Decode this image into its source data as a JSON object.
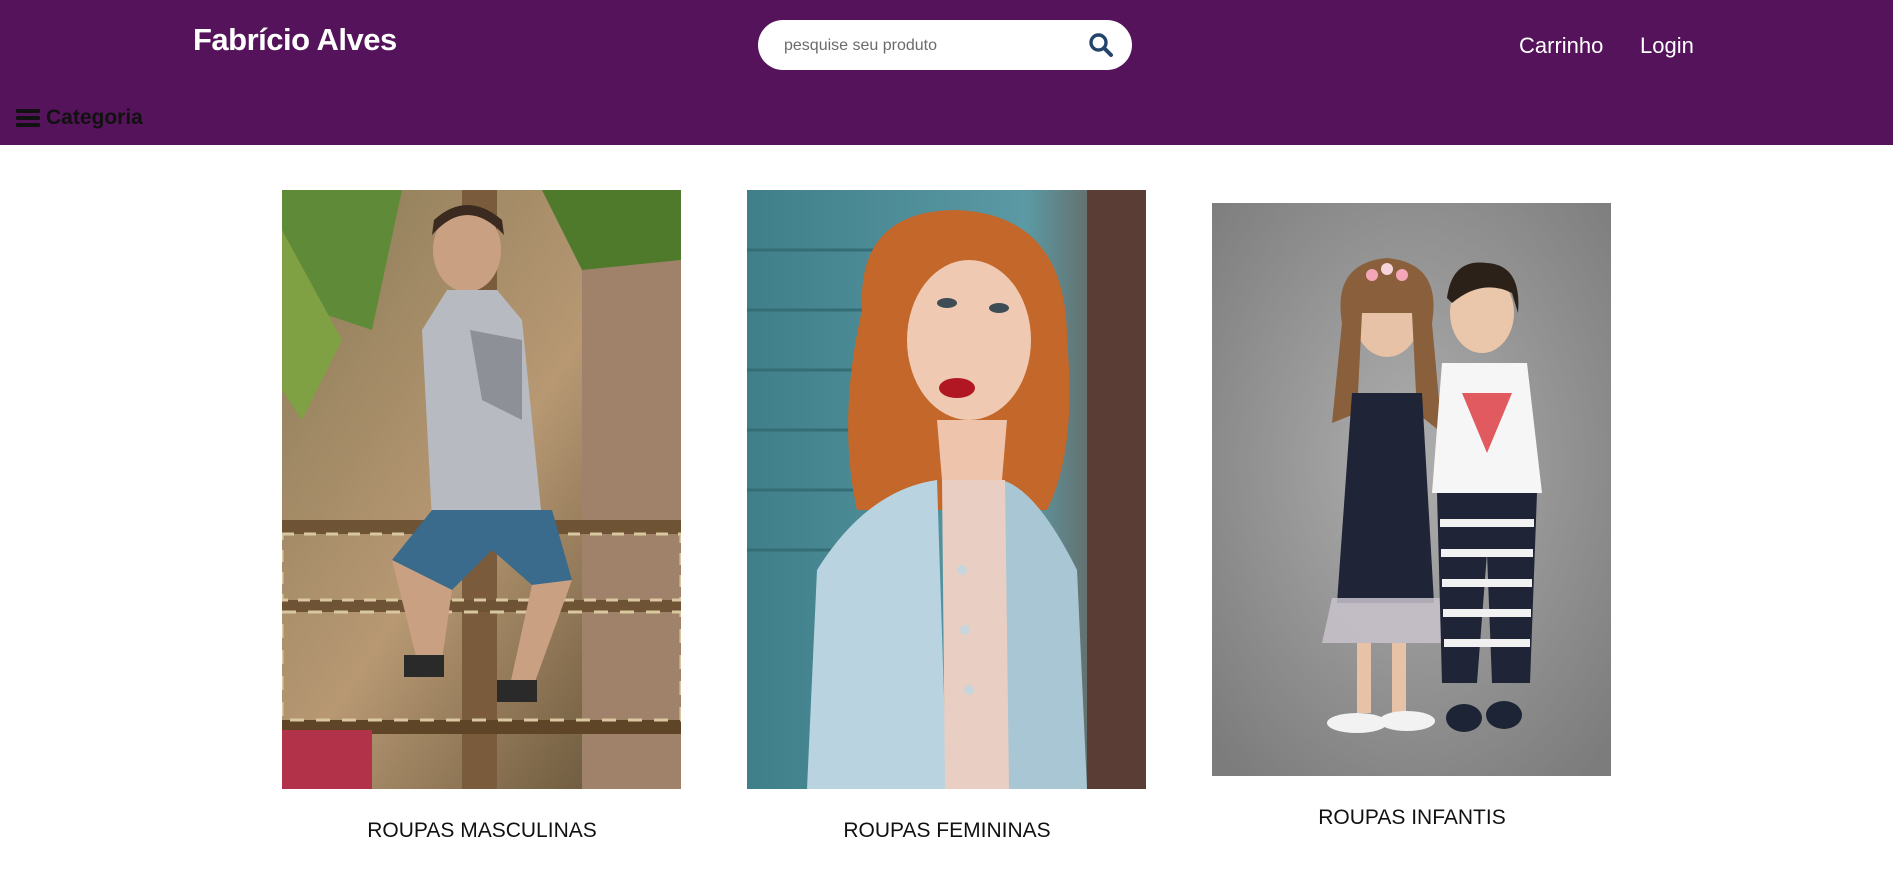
{
  "header": {
    "brand": "Fabrício Alves",
    "search": {
      "placeholder": "pesquise seu produto",
      "icon": "search-icon"
    },
    "nav": {
      "cart": "Carrinho",
      "login": "Login"
    },
    "category_menu": {
      "label": "Categoria",
      "icon": "hamburger-menu-icon"
    },
    "colors": {
      "background": "#54135a",
      "text": "#ffffff",
      "search_icon": "#23446b"
    }
  },
  "categories": [
    {
      "label": "ROUPAS MASCULINAS"
    },
    {
      "label": "ROUPAS FEMININAS"
    },
    {
      "label": "ROUPAS INFANTIS"
    }
  ]
}
